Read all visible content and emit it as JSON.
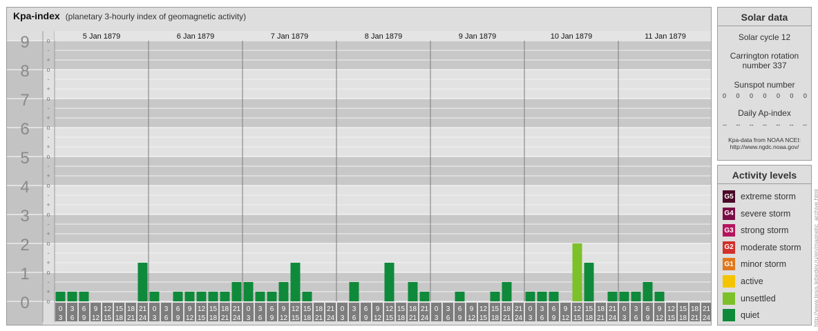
{
  "title": "Kpa-index",
  "subtitle": "(planetary 3-hourly index of geomagnetic activity)",
  "chart_data": {
    "type": "bar",
    "title": "Kpa-index",
    "subtitle": "(planetary 3-hourly index of geomagnetic activity)",
    "ylim": [
      0,
      9
    ],
    "y_tick_labels": [
      "0",
      "1",
      "2",
      "3",
      "4",
      "5",
      "6",
      "7",
      "8",
      "9"
    ],
    "y_minor_labels": [
      "o",
      "+",
      "-"
    ],
    "days": [
      "5 Jan 1879",
      "6 Jan 1879",
      "7 Jan 1879",
      "8 Jan 1879",
      "9 Jan 1879",
      "10 Jan 1879",
      "11 Jan 1879"
    ],
    "interval_start_labels": [
      "0",
      "3",
      "6",
      "9",
      "12",
      "15",
      "18",
      "21"
    ],
    "interval_end_labels": [
      "3",
      "6",
      "9",
      "12",
      "15",
      "18",
      "21",
      "24"
    ],
    "values": [
      0.333,
      0.333,
      0.333,
      0,
      0,
      0,
      0,
      1.333,
      0.333,
      0,
      0.333,
      0.333,
      0.333,
      0.333,
      0.333,
      0.667,
      0.667,
      0.333,
      0.333,
      0.667,
      1.333,
      0.333,
      0,
      0,
      0,
      0.667,
      0,
      0,
      1.333,
      0,
      0.667,
      0.333,
      0,
      0,
      0.333,
      0,
      0,
      0.333,
      0.667,
      0,
      0.333,
      0.333,
      0.333,
      0,
      2.0,
      1.333,
      0,
      0.333,
      0.333,
      0.333,
      0.667,
      0.333,
      0,
      0,
      0,
      0
    ],
    "grid": true,
    "legend": "right"
  },
  "solar": {
    "header": "Solar data",
    "cycle": "Solar cycle 12",
    "carrington_line1": "Carrington rotation",
    "carrington_line2": "number 337",
    "sunspot_label": "Sunspot number",
    "sunspot_values": [
      "0",
      "0",
      "0",
      "0",
      "0",
      "0",
      "0"
    ],
    "ap_label": "Daily Ap-index",
    "ap_values": [
      "--",
      "--",
      "--",
      "--",
      "--",
      "--",
      "--"
    ],
    "source_line1": "Kpa-data from NOAA NCEI:",
    "source_line2": "http://www.ngdc.noaa.gov/"
  },
  "activity": {
    "header": "Activity levels",
    "levels": [
      {
        "badge": "G5",
        "label": "extreme storm",
        "color": "#4a0628"
      },
      {
        "badge": "G4",
        "label": "severe storm",
        "color": "#7a0d45"
      },
      {
        "badge": "G3",
        "label": "strong storm",
        "color": "#b5155e"
      },
      {
        "badge": "G2",
        "label": "moderate storm",
        "color": "#d2302c"
      },
      {
        "badge": "G1",
        "label": "minor storm",
        "color": "#e0781b"
      },
      {
        "badge": "",
        "label": "active",
        "color": "#f5c400"
      },
      {
        "badge": "",
        "label": "unsettled",
        "color": "#7dc12a"
      },
      {
        "badge": "",
        "label": "quiet",
        "color": "#0f8a3a"
      }
    ]
  },
  "credit": "http://www.tesis.lebedev.ru/en/magnetic_archive.html",
  "colors": {
    "quiet": "#0f8a3a",
    "unsettled": "#7dc12a",
    "band_dark": "#c8c8c8",
    "band_light": "#e2e2e2",
    "axis_text": "#8a8a8a"
  }
}
